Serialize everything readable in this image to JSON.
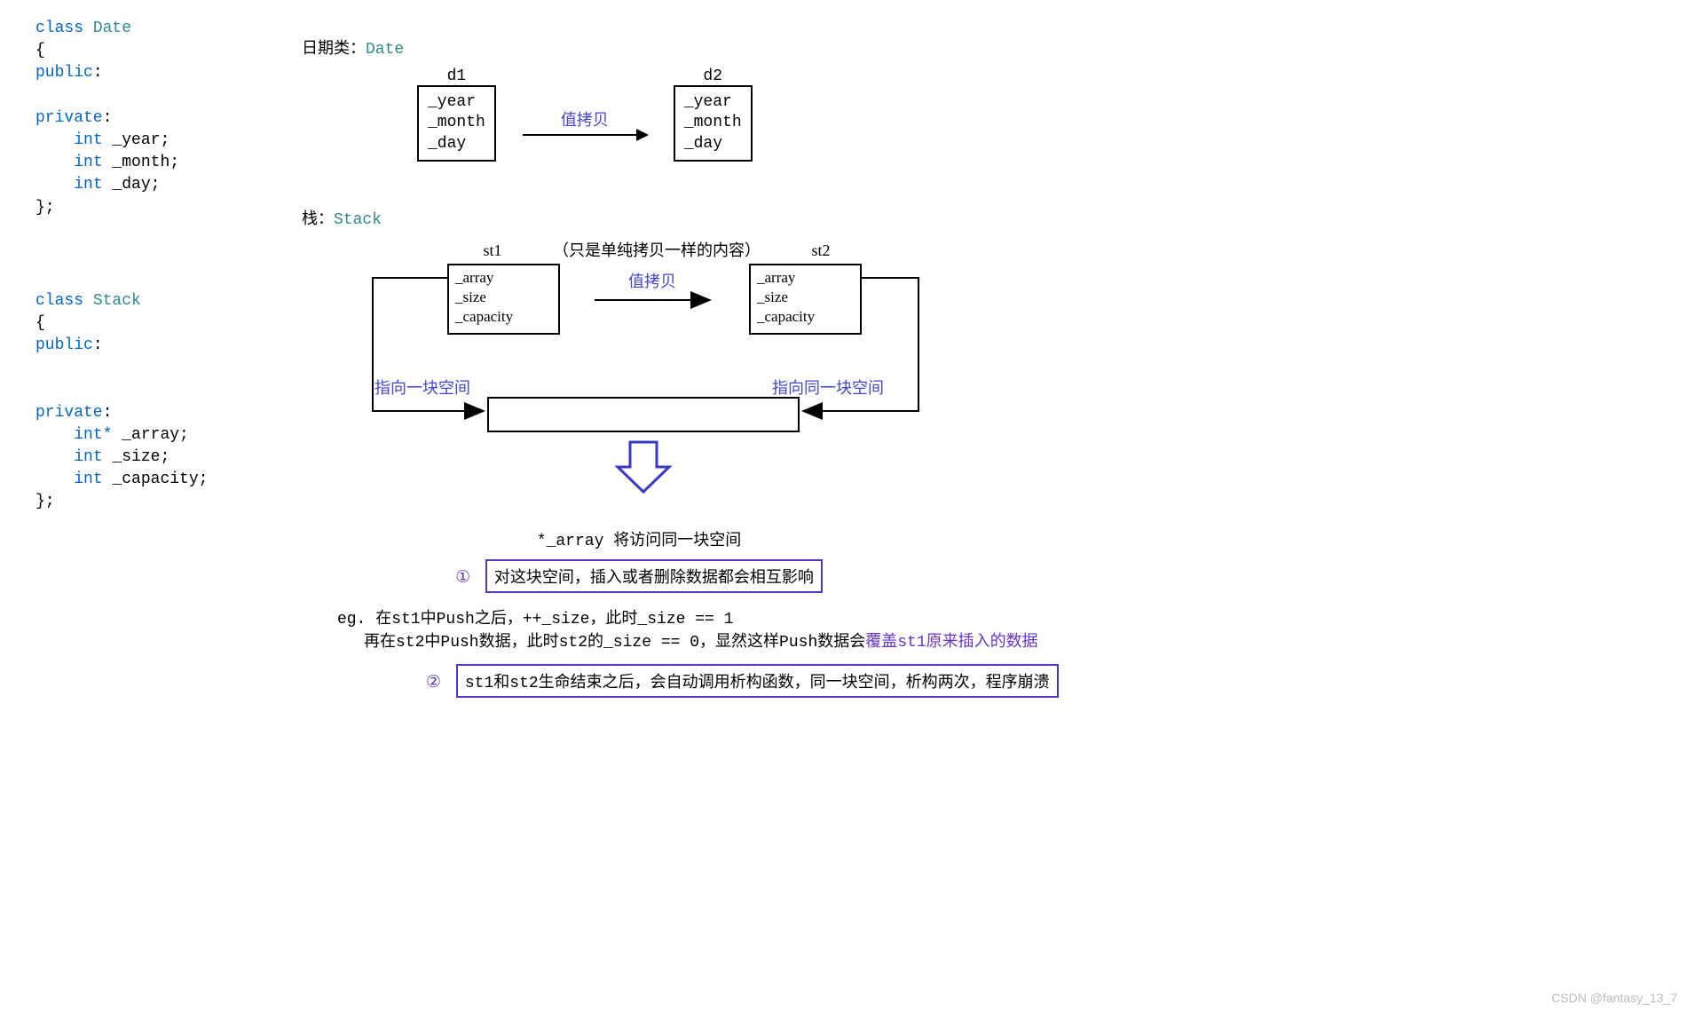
{
  "code_date": {
    "l1a": "class",
    "l1b": "Date",
    "l2": "{",
    "l3": "public",
    "l5": "private",
    "l6a": "int",
    "l6b": "_year;",
    "l7a": "int",
    "l7b": "_month;",
    "l8a": "int",
    "l8b": "_day;",
    "l9": "};"
  },
  "code_stack": {
    "l1a": "class",
    "l1b": "Stack",
    "l2": "{",
    "l3": "public",
    "l5": "private",
    "l6a": "int*",
    "l6b": "_array;",
    "l7a": "int",
    "l7b": "_size;",
    "l8a": "int",
    "l8b": "_capacity;",
    "l9": "};"
  },
  "heading_date_a": "日期类：",
  "heading_date_b": "Date",
  "heading_stack_a": "栈：",
  "heading_stack_b": "Stack",
  "date_diag": {
    "d1": "d1",
    "d2": "d2",
    "box": "_year\n_month\n_day",
    "arrow_label": "值拷贝"
  },
  "stack_diag": {
    "st1": "st1",
    "st2": "st2",
    "note": "（只是单纯拷贝一样的内容）",
    "box": "_array\n_size\n_capacity",
    "arrow_label": "值拷贝",
    "left_label": "指向一块空间",
    "right_label": "指向同一块空间"
  },
  "summary": {
    "deref": "*_array",
    "deref_rest": "将访问同一块空间",
    "c1": "①",
    "b1": "对这块空间，插入或者删除数据都会相互影响",
    "eg1": "eg.  在st1中Push之后，++_size，此时_size == 1",
    "eg2a": "再在st2中Push数据，此时st2的_size == 0，显然这样Push数据会",
    "eg2b": "覆盖st1原来插入的数据",
    "c2": "②",
    "b2": "st1和st2生命结束之后，会自动调用析构函数，同一块空间，析构两次，程序崩溃"
  },
  "watermark": "CSDN @fantasy_13_7"
}
